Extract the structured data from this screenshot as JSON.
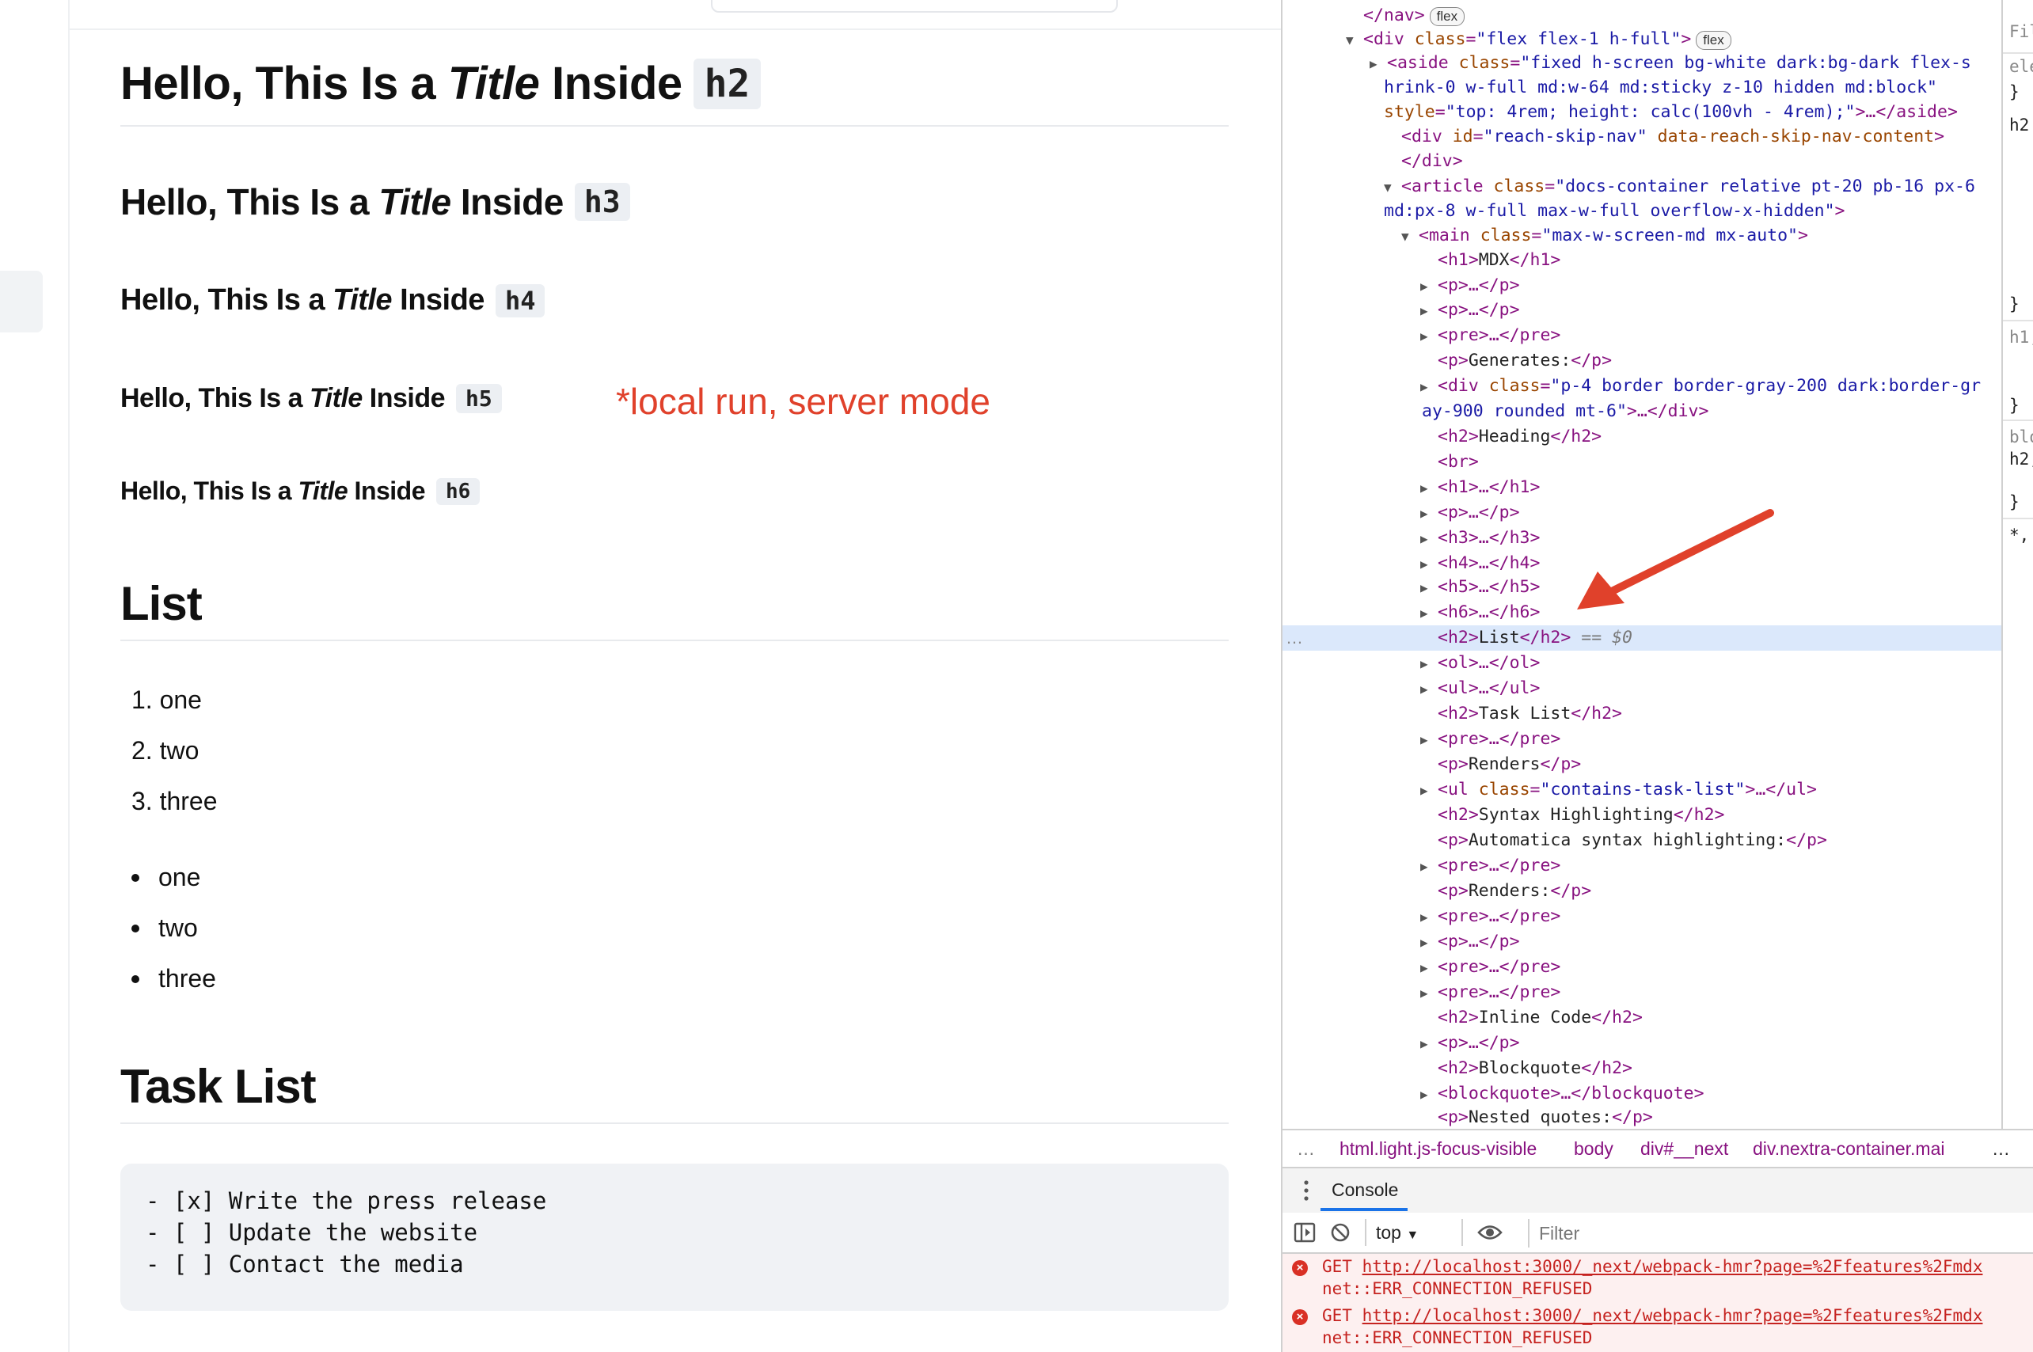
{
  "page": {
    "headings": [
      {
        "bold": "Hello",
        "middle": ", This Is a ",
        "italic": "Title",
        "end": " Inside",
        "tag": "h2"
      },
      {
        "bold": "Hello",
        "middle": ", This Is a ",
        "italic": "Title",
        "end": " Inside",
        "tag": "h3"
      },
      {
        "bold": "Hello",
        "middle": ", This Is a ",
        "italic": "Title",
        "end": " Inside",
        "tag": "h4"
      },
      {
        "bold": "Hello",
        "middle": ", This Is a ",
        "italic": "Title",
        "end": " Inside",
        "tag": "h5"
      },
      {
        "bold": "Hello",
        "middle": ", This Is a ",
        "italic": "Title",
        "end": " Inside",
        "tag": "h6"
      }
    ],
    "annotation": "*local run, server mode",
    "list_heading": "List",
    "ordered_list": [
      "1. one",
      "2. two",
      "3. three"
    ],
    "unordered_list": [
      "one",
      "two",
      "three"
    ],
    "task_heading": "Task List",
    "task_code": [
      "- [x] Write the press release",
      "- [ ] Update the website",
      "- [ ] Contact the media"
    ]
  },
  "devtools": {
    "dom": {
      "l0": {
        "close": "</nav>",
        "badge": "flex"
      },
      "l1": {
        "open": "<div",
        "attr": "class",
        "val": "\"flex flex-1 h-full\"",
        "close": ">",
        "badge": "flex"
      },
      "l2a": {
        "open": "<aside",
        "attr": "class",
        "val": "\"fixed h-screen bg-white dark:bg-dark flex-s"
      },
      "l2b": {
        "val": "hrink-0 w-full md:w-64 md:sticky z-10 hidden md:block\""
      },
      "l2c": {
        "attr": "style",
        "val": "\"top: 4rem; height: calc(100vh - 4rem);\"",
        "close": ">…</aside>"
      },
      "l3": {
        "open": "<div",
        "attr1": "id",
        "val1": "\"reach-skip-nav\"",
        "attr2": "data-reach-skip-nav-content",
        "close": ">"
      },
      "l4": {
        "close": "</div>"
      },
      "l5a": {
        "open": "<article",
        "attr": "class",
        "val": "\"docs-container relative pt-20 pb-16 px-6"
      },
      "l5b": {
        "val": "md:px-8 w-full max-w-full overflow-x-hidden\"",
        "close": ">"
      },
      "l6": {
        "open": "<main",
        "attr": "class",
        "val": "\"max-w-screen-md mx-auto\"",
        "close": ">"
      },
      "l7": {
        "open": "<h1>",
        "text": "MDX",
        "close": "</h1>"
      },
      "l8": {
        "text": "<p>…</p>"
      },
      "l9": {
        "text": "<p>…</p>"
      },
      "l10": {
        "text": "<pre>…</pre>"
      },
      "l11": {
        "open": "<p>",
        "text": "Generates:",
        "close": "</p>"
      },
      "l12a": {
        "open": "<div",
        "attr": "class",
        "val": "\"p-4 border border-gray-200 dark:border-gr"
      },
      "l12b": {
        "val": "ay-900 rounded mt-6\"",
        "close": ">…</div>"
      },
      "l13": {
        "open": "<h2>",
        "text": "Heading",
        "close": "</h2>"
      },
      "l14": {
        "text": "<br>"
      },
      "l15": {
        "text": "<h1>…</h1>"
      },
      "l16": {
        "text": "<p>…</p>"
      },
      "l17": {
        "text": "<h3>…</h3>"
      },
      "l18": {
        "text": "<h4>…</h4>"
      },
      "l19": {
        "text": "<h5>…</h5>"
      },
      "l20": {
        "text": "<h6>…</h6>"
      },
      "l21": {
        "open": "<h2>",
        "text": "List",
        "close": "</h2>",
        "eq": "==",
        "sv": "$0",
        "dots": "…"
      },
      "l22": {
        "text": "<ol>…</ol>"
      },
      "l23": {
        "text": "<ul>…</ul>"
      },
      "l24": {
        "open": "<h2>",
        "text": "Task List",
        "close": "</h2>"
      },
      "l25": {
        "text": "<pre>…</pre>"
      },
      "l26": {
        "open": "<p>",
        "text": "Renders",
        "close": "</p>"
      },
      "l27": {
        "open": "<ul",
        "attr": "class",
        "val": "\"contains-task-list\"",
        "close": ">…</ul>"
      },
      "l28": {
        "open": "<h2>",
        "text": "Syntax Highlighting",
        "close": "</h2>"
      },
      "l29": {
        "open": "<p>",
        "text": "Automatica syntax highlighting:",
        "close": "</p>"
      },
      "l30": {
        "text": "<pre>…</pre>"
      },
      "l31": {
        "open": "<p>",
        "text": "Renders:",
        "close": "</p>"
      },
      "l32": {
        "text": "<pre>…</pre>"
      },
      "l33": {
        "text": "<p>…</p>"
      },
      "l34": {
        "text": "<pre>…</pre>"
      },
      "l35": {
        "text": "<pre>…</pre>"
      },
      "l36": {
        "open": "<h2>",
        "text": "Inline Code",
        "close": "</h2>"
      },
      "l37": {
        "text": "<p>…</p>"
      },
      "l38": {
        "open": "<h2>",
        "text": "Blockquote",
        "close": "</h2>"
      },
      "l39": {
        "text": "<blockquote>…</blockquote>"
      },
      "l40": {
        "open": "<p>",
        "text": "Nested quotes:",
        "close": "</p>"
      }
    },
    "styles_fragments": [
      "Fil",
      "ele",
      "}",
      "h2",
      "}",
      "h1,",
      "}",
      "blo",
      "h2,",
      "}",
      "*,"
    ],
    "breadcrumbs": [
      "html.light.js-focus-visible",
      "body",
      "div#__next",
      "div.nextra-container.mai"
    ],
    "breadcrumb_left_dots": "…",
    "breadcrumb_more": "…",
    "console": {
      "tab_label": "Console",
      "context": "top",
      "filter_placeholder": "Filter",
      "errors": [
        {
          "method": "GET",
          "url": "http://localhost:3000/_next/webpack-hmr?page=%2Ffeatures%2Fmdx",
          "message": "net::ERR_CONNECTION_REFUSED"
        },
        {
          "method": "GET",
          "url": "http://localhost:3000/_next/webpack-hmr?page=%2Ffeatures%2Fmdx",
          "message": "net::ERR_CONNECTION_REFUSED"
        }
      ]
    },
    "colors": {
      "selected_row": "#dbe8fb",
      "arrow": "#e0412b",
      "tag": "#881280",
      "attr_name": "#994500",
      "attr_value": "#1a1aa6",
      "error": "#c5221f"
    }
  }
}
